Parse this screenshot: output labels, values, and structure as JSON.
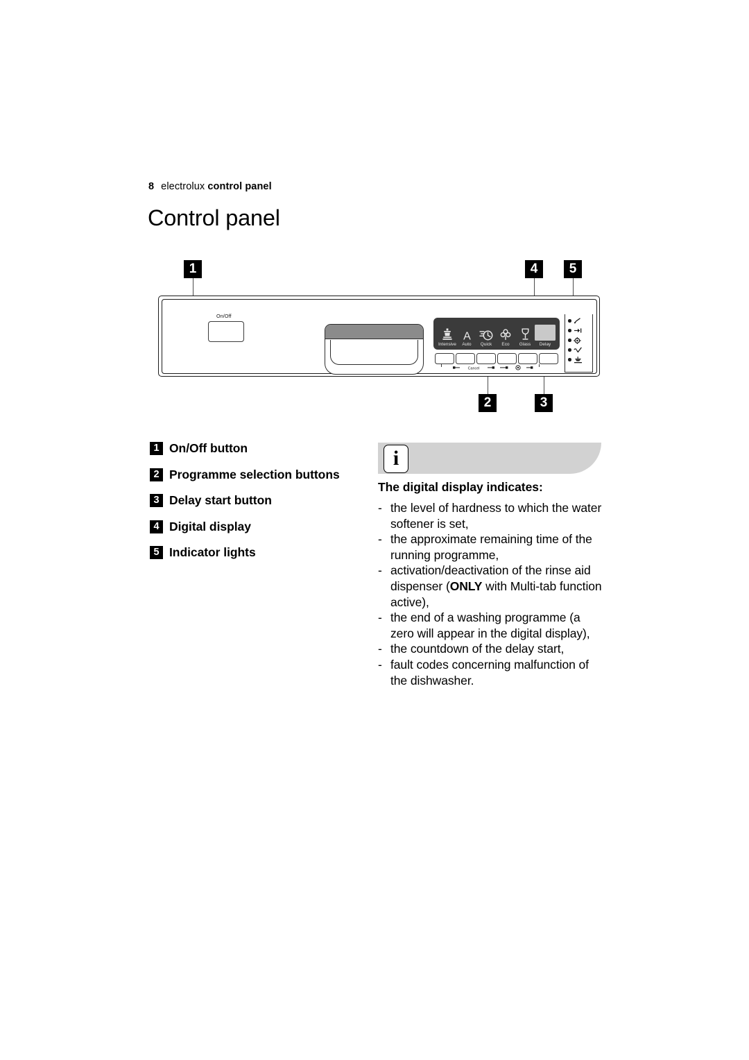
{
  "page": {
    "number": "8",
    "brand": "electrolux",
    "section": "control panel",
    "title": "Control panel"
  },
  "figure": {
    "onoff": {
      "label": "On/Off"
    },
    "programmes": [
      {
        "label": "Intensive",
        "icon": "pot-icon"
      },
      {
        "label": "Auto",
        "icon": "letter-a-icon"
      },
      {
        "label": "Quick",
        "icon": "clock-fast-icon"
      },
      {
        "label": "Eco",
        "icon": "clover-leaf-icon"
      },
      {
        "label": "Glass",
        "icon": "wine-glass-icon"
      },
      {
        "label": "Delay",
        "icon": "digital-display-box"
      }
    ],
    "markings": {
      "cancel": "Cancel",
      "multitab": "multi-tab-symbol"
    },
    "indicators": [
      {
        "icon": "rinse-aid-icon"
      },
      {
        "icon": "salt-icon"
      },
      {
        "icon": "multitab-icon"
      },
      {
        "icon": "end-tick-icon"
      },
      {
        "icon": "drying-icon"
      }
    ],
    "callouts": [
      {
        "number": "1"
      },
      {
        "number": "2"
      },
      {
        "number": "3"
      },
      {
        "number": "4"
      },
      {
        "number": "5"
      }
    ]
  },
  "legend": [
    {
      "number": "1",
      "label": "On/Off button"
    },
    {
      "number": "2",
      "label": "Programme selection buttons"
    },
    {
      "number": "3",
      "label": "Delay start button"
    },
    {
      "number": "4",
      "label": "Digital display"
    },
    {
      "number": "5",
      "label": "Indicator lights"
    }
  ],
  "info": {
    "icon": "i",
    "heading": "The digital display indicates:",
    "dash": "-",
    "items": [
      {
        "text_before": "the level of hardness to which the water softener is set,",
        "bold": "",
        "text_after": ""
      },
      {
        "text_before": "the approximate remaining time of the running programme,",
        "bold": "",
        "text_after": ""
      },
      {
        "text_before": "activation/deactivation of the rinse aid dispenser (",
        "bold": "ONLY",
        "text_after": " with Multi-tab function active),"
      },
      {
        "text_before": "the end of a washing programme (a zero will appear in the digital display),",
        "bold": "",
        "text_after": ""
      },
      {
        "text_before": "the countdown of the delay start,",
        "bold": "",
        "text_after": ""
      },
      {
        "text_before": "fault codes concerning malfunction of the dishwasher.",
        "bold": "",
        "text_after": ""
      }
    ]
  }
}
